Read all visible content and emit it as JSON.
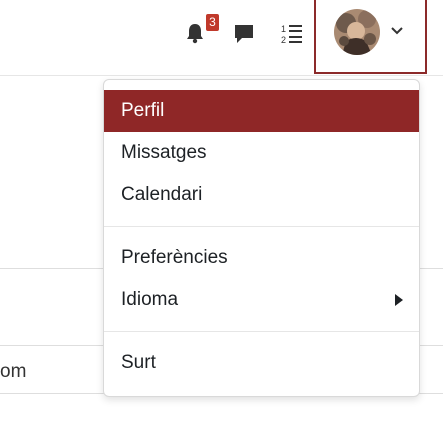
{
  "navbar": {
    "notification_count": "3",
    "icons": {
      "notifications": "bell-icon",
      "messages": "chat-bubble-icon",
      "courses": "ordered-list-icon",
      "dropdown": "chevron-down-icon"
    }
  },
  "background": {
    "partial_text": "om"
  },
  "user_menu": {
    "items": [
      {
        "label": "Perfil"
      },
      {
        "label": "Missatges"
      },
      {
        "label": "Calendari"
      },
      {
        "label": "Preferències"
      },
      {
        "label": "Idioma"
      },
      {
        "label": "Surt"
      }
    ]
  },
  "colors": {
    "accent": "#8f2727",
    "badge": "#c0392b"
  }
}
